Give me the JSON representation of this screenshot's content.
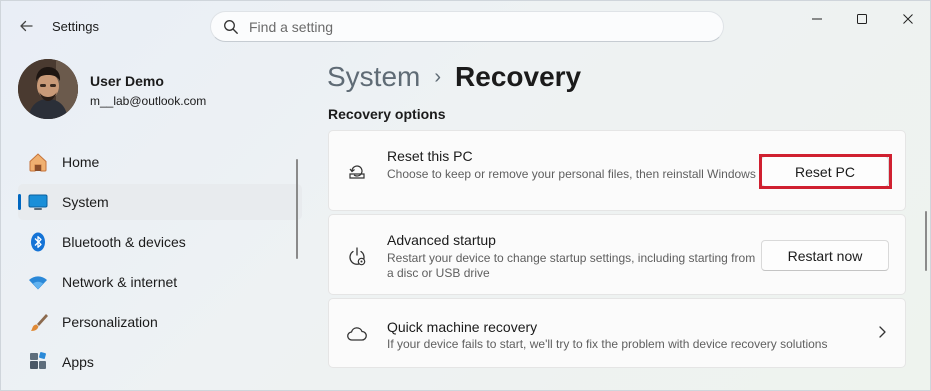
{
  "app": {
    "title": "Settings"
  },
  "search": {
    "placeholder": "Find a setting"
  },
  "profile": {
    "name": "User Demo",
    "email": "m__lab@outlook.com"
  },
  "nav": {
    "items": [
      {
        "label": "Home",
        "icon": "home-icon",
        "active": false
      },
      {
        "label": "System",
        "icon": "system-icon",
        "active": true
      },
      {
        "label": "Bluetooth & devices",
        "icon": "bluetooth-icon",
        "active": false
      },
      {
        "label": "Network & internet",
        "icon": "wifi-icon",
        "active": false
      },
      {
        "label": "Personalization",
        "icon": "brush-icon",
        "active": false
      },
      {
        "label": "Apps",
        "icon": "apps-icon",
        "active": false
      }
    ]
  },
  "breadcrumb": {
    "parent": "System",
    "separator": "›",
    "current": "Recovery"
  },
  "section": {
    "title": "Recovery options"
  },
  "cards": [
    {
      "title": "Reset this PC",
      "description": "Choose to keep or remove your personal files, then reinstall Windows",
      "button": "Reset PC",
      "icon": "reset-pc-icon"
    },
    {
      "title": "Advanced startup",
      "description": "Restart your device to change startup settings, including starting from a disc or USB drive",
      "button": "Restart now",
      "icon": "advanced-startup-icon"
    },
    {
      "title": "Quick machine recovery",
      "description": "If your device fails to start, we'll try to fix the problem with device recovery solutions",
      "icon": "cloud-icon"
    }
  ],
  "colors": {
    "accent": "#0067c0",
    "highlight": "#d02030"
  }
}
